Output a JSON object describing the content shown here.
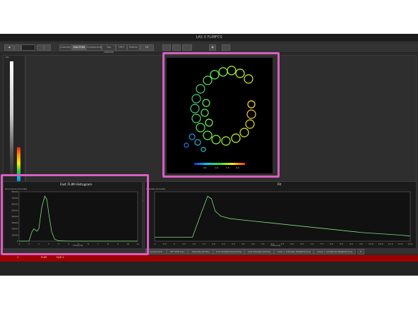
{
  "app": {
    "title": "LAS X FLIMFCS"
  },
  "toolbar": {
    "tabs": [
      "Intensity",
      "Fast FLIM",
      "Components",
      "Tau Lifetime",
      "FRET",
      "Pattern"
    ],
    "active_tab_index": 1,
    "fit_button": "Fit"
  },
  "left_panel": {
    "label": "Int."
  },
  "image": {
    "scale_labels": [
      "0.5",
      "1.0",
      "1.5",
      "2.0"
    ]
  },
  "histogram": {
    "title": "Fast FLIM Histogram",
    "ylabel": "Occurrence [Counts]",
    "xlabel": "Time [ns]"
  },
  "fit_chart": {
    "title": "Fit",
    "ylabel": "Intensity [Counts]",
    "xlabel": "Time [ns]"
  },
  "bottom_tabs": [
    "Component",
    "IRF Shift [ns]",
    "Intensity [kCnts]",
    "Sum Amplitudes [kCnts]",
    "Lost Intensity [kCnts]",
    "τAver. I. Intensity Weighted [ns]",
    "τAver. I. Amplitude Weighted [ns]"
  ],
  "table_row": {
    "index": "1",
    "name": "FLIM",
    "channel": "HyD 2"
  },
  "chart_data": [
    {
      "type": "line",
      "title": "Fast FLIM Histogram",
      "xlabel": "Time [ns]",
      "ylabel": "Occurrence [Counts]",
      "x": [
        -1,
        0,
        0.3,
        0.5,
        0.8,
        1.0,
        1.3,
        1.6,
        1.8,
        2.0,
        2.3,
        2.6,
        3.0,
        4,
        6,
        8,
        10,
        11
      ],
      "y": [
        0,
        0,
        15000,
        20000,
        16000,
        20000,
        55000,
        73000,
        68000,
        45000,
        15000,
        3000,
        500,
        0,
        0,
        0,
        0,
        0
      ],
      "xlim": [
        -1,
        11
      ],
      "ylim": [
        0,
        80000
      ],
      "yticks": [
        "0",
        "10000",
        "20000",
        "30000",
        "40000",
        "50000",
        "60000",
        "70000",
        "80000"
      ],
      "xticks": [
        "-1",
        "0",
        "1",
        "2",
        "3",
        "4",
        "5",
        "6",
        "7",
        "8",
        "9",
        "10",
        "11"
      ]
    },
    {
      "type": "line",
      "title": "Fit",
      "xlabel": "Time [ns]",
      "ylabel": "Intensity [Counts]",
      "x": [
        -1,
        0,
        1.0,
        1.5,
        1.8,
        2.0,
        2.2,
        2.5,
        3,
        4,
        6,
        8,
        10,
        12,
        12.5
      ],
      "y": [
        8,
        8,
        8,
        60,
        90,
        85,
        60,
        50,
        45,
        41,
        33,
        25,
        17,
        12,
        10
      ],
      "xlim": [
        -1,
        12.5
      ],
      "xticks": [
        "-1",
        "-0.5",
        "0",
        "0.5",
        "1.0",
        "1.5",
        "2.0",
        "2.5",
        "3.0",
        "3.5",
        "4.0",
        "4.5",
        "5.0",
        "5.5",
        "6.0",
        "6.5",
        "7.0",
        "7.5",
        "8.0",
        "8.5",
        "9.0",
        "9.5",
        "10.0",
        "10.5",
        "11.0",
        "11.5",
        "12.0"
      ]
    }
  ],
  "colors": {
    "highlight": "#d95fbf",
    "trace": "#7fdc7f",
    "error_bar": "#a00000"
  }
}
